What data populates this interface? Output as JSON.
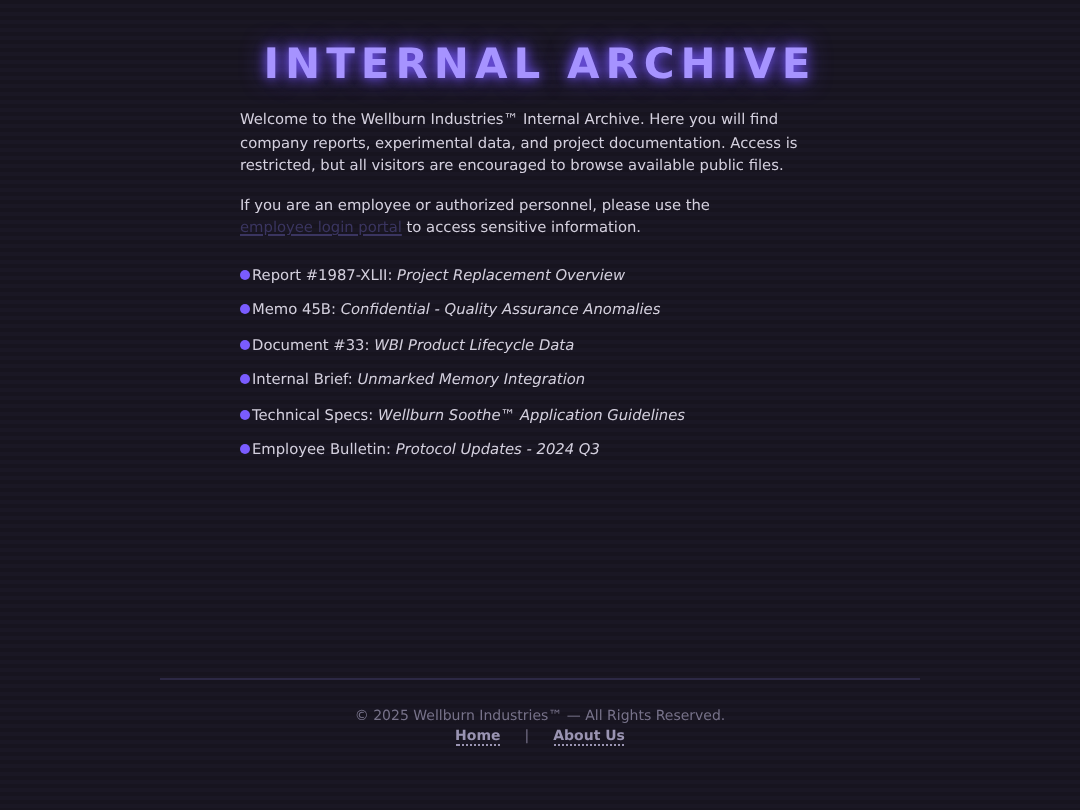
{
  "title": "INTERNAL ARCHIVE",
  "intro": "Welcome to the Wellburn Industries™ Internal Archive. Here you will find company reports, experimental data, and project documentation. Access is restricted, but all visitors are encouraged to browse available public files.",
  "login_note": {
    "before": "If you are an employee or authorized personnel, please use the",
    "link": "employee login portal",
    "after": "to access sensitive information."
  },
  "documents": [
    {
      "label": "Report #1987-XLII:",
      "title": "Project Replacement Overview"
    },
    {
      "label": "Memo 45B:",
      "title": "Confidential - Quality Assurance Anomalies"
    },
    {
      "label": "Document #33:",
      "title": "WBI Product Lifecycle Data"
    },
    {
      "label": "Internal Brief:",
      "title": "Unmarked Memory Integration"
    },
    {
      "label": "Technical Specs:",
      "title": "Wellburn Soothe™ Application Guidelines"
    },
    {
      "label": "Employee Bulletin:",
      "title": "Protocol Updates - 2024 Q3"
    }
  ],
  "footer": {
    "copyright": "© 2025 Wellburn Industries™ — All Rights Reserved.",
    "links": [
      "Home",
      "About Us"
    ],
    "separator": "|"
  }
}
